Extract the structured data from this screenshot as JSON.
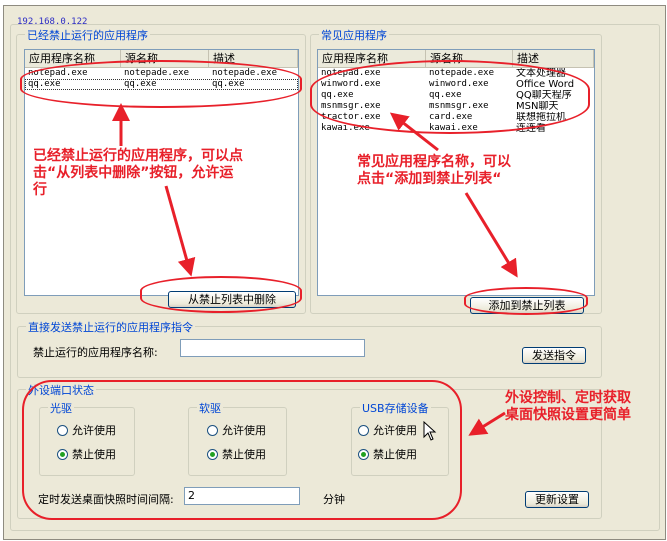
{
  "ip_address": "192.168.0.122",
  "blocked_group": {
    "title": "已经禁止运行的应用程序",
    "columns": [
      "应用程序名称",
      "源名称",
      "描述"
    ],
    "rows": [
      [
        "notepad.exe",
        "notepade.exe",
        "notepade.exe"
      ],
      [
        "qq.exe",
        "qq.exe",
        "qq.exe"
      ]
    ],
    "remove_button": "从禁止列表中删除"
  },
  "common_group": {
    "title": "常见应用程序",
    "columns": [
      "应用程序名称",
      "源名称",
      "描述"
    ],
    "rows": [
      [
        "notepad.exe",
        "notepade.exe",
        "文本处理器"
      ],
      [
        "winword.exe",
        "winword.exe",
        "Office Word"
      ],
      [
        "qq.exe",
        "qq.exe",
        "QQ聊天程序"
      ],
      [
        "msnmsgr.exe",
        "msnmsgr.exe",
        "MSN聊天"
      ],
      [
        "tractor.exe",
        "card.exe",
        "联想拖拉机"
      ],
      [
        "kawai.exe",
        "kawai.exe",
        "连连看"
      ]
    ],
    "add_button": "添加到禁止列表"
  },
  "direct_group": {
    "title": "直接发送禁止运行的应用程序指令",
    "label": "禁止运行的应用程序名称:",
    "value": "",
    "send_button": "发送指令"
  },
  "ports_group": {
    "title": "外设端口状态",
    "cdrom": {
      "title": "光驱",
      "allow": "允许使用",
      "deny": "禁止使用",
      "selected": "deny"
    },
    "floppy": {
      "title": "软驱",
      "allow": "允许使用",
      "deny": "禁止使用",
      "selected": "deny"
    },
    "usb": {
      "title": "USB存储设备",
      "allow": "允许使用",
      "deny": "禁止使用",
      "selected": "deny"
    },
    "interval_label": "定时发送桌面快照时间间隔:",
    "interval_value": "2",
    "interval_unit": "分钟",
    "update_button": "更新设置"
  },
  "annotations": {
    "left": "已经禁止运行的应用程序，可以点击“从列表中删除”按钮，允许运行",
    "left_lines": [
      "已经禁止运行的应用程序，可以点",
      "击“从列表中删除”按钮，允许运",
      "行"
    ],
    "right_lines": [
      "常见应用程序名称，可以",
      "点击“添加到禁止列表“"
    ],
    "bottom_lines": [
      "外设控制、定时获取",
      "桌面快照设置更简单"
    ],
    "color": "#e8202a"
  }
}
